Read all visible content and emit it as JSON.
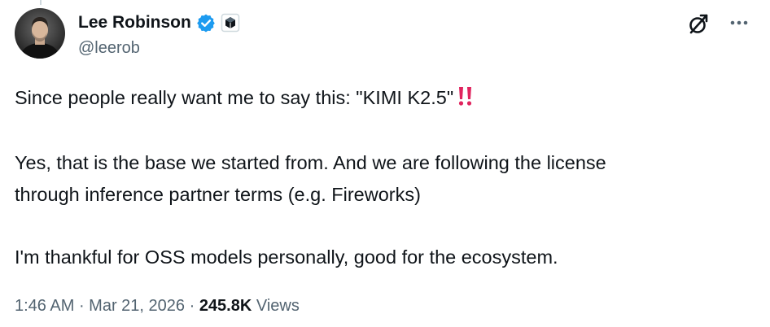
{
  "author": {
    "display_name": "Lee Robinson",
    "handle": "@leerob",
    "avatar_icon": "person-avatar-icon",
    "verified_icon": "verified-badge-icon",
    "affiliate_icon": "affiliate-badge-icon",
    "verified_color": "#1d9bf0"
  },
  "header_actions": {
    "grok_icon": "grok-icon",
    "more_icon": "more-horizontal-icon"
  },
  "tweet": {
    "line1": "Since people really want me to say this: \"KIMI K2.5\"",
    "emphasis_icon": "double-exclamation-icon",
    "emphasis_color": "#e0245e",
    "line2": "Yes, that is the base we started from. And we are following the license\nthrough inference partner terms (e.g. Fireworks)",
    "line3": "I'm thankful for OSS models personally, good for the ecosystem."
  },
  "meta": {
    "time": "1:46 AM",
    "sep1": " · ",
    "date": "Mar 21, 2026",
    "sep2": " · ",
    "views_count": "245.8K",
    "views_label": " Views"
  }
}
